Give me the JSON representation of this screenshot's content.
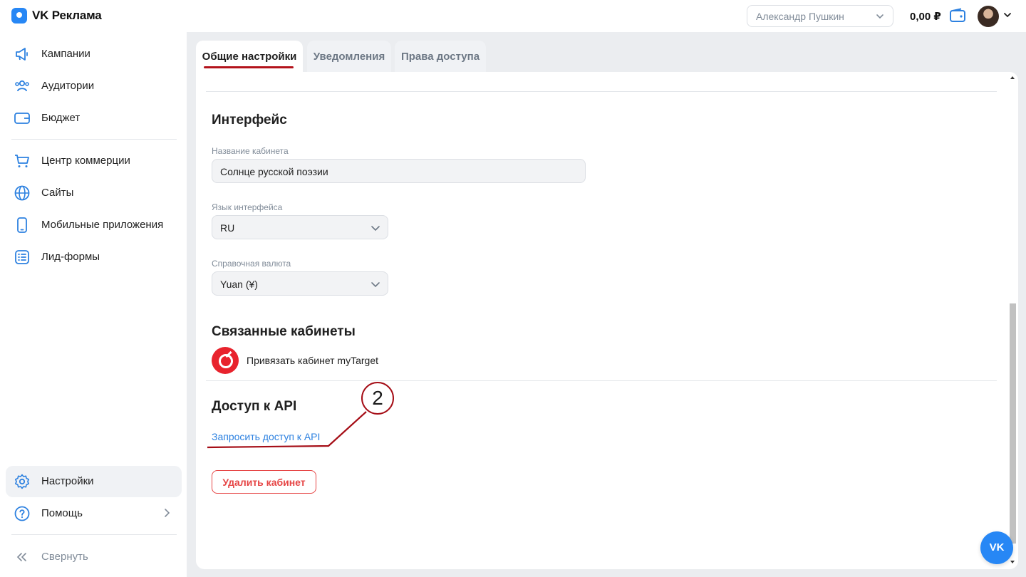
{
  "app": {
    "logo_text": "VK Реклама",
    "brand_color": "#2787f5"
  },
  "header": {
    "account_name": "Александр Пушкин",
    "balance": "0,00 ₽"
  },
  "sidebar": {
    "items": [
      {
        "label": "Кампании",
        "icon": "megaphone-icon"
      },
      {
        "label": "Аудитории",
        "icon": "people-icon"
      },
      {
        "label": "Бюджет",
        "icon": "wallet-icon"
      },
      {
        "label": "Центр коммерции",
        "icon": "cart-icon"
      },
      {
        "label": "Сайты",
        "icon": "globe-icon"
      },
      {
        "label": "Мобильные приложения",
        "icon": "phone-icon"
      },
      {
        "label": "Лид-формы",
        "icon": "list-icon"
      }
    ],
    "bottom": [
      {
        "label": "Настройки",
        "icon": "gear-icon",
        "active": true
      },
      {
        "label": "Помощь",
        "icon": "question-icon"
      }
    ],
    "collapse_label": "Свернуть"
  },
  "tabs": [
    {
      "label": "Общие настройки",
      "active": true
    },
    {
      "label": "Уведомления"
    },
    {
      "label": "Права доступа"
    }
  ],
  "interface": {
    "title": "Интерфейс",
    "cabinet_name_label": "Название кабинета",
    "cabinet_name_value": "Солнце русской поэзии",
    "language_label": "Язык интерфейса",
    "language_value": "RU",
    "currency_label": "Справочная валюта",
    "currency_value": "Yuan (¥)"
  },
  "linked": {
    "title": "Связанные кабинеты",
    "link_label": "Привязать кабинет myTarget"
  },
  "api": {
    "title": "Доступ к API",
    "request_link": "Запросить доступ к API"
  },
  "delete_button": "Удалить кабинет",
  "annotation": {
    "number": "2",
    "color": "#a50d16"
  },
  "fab_label": "VK"
}
